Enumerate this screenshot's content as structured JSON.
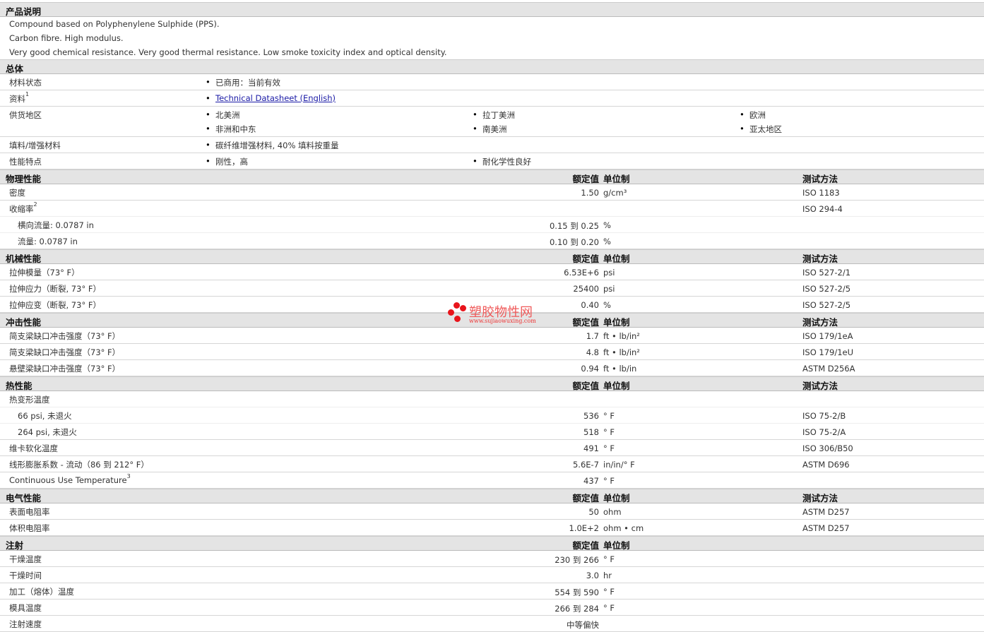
{
  "sections": [
    {
      "title": "产品说明",
      "desc": [
        "Compound based on Polyphenylene Sulphide (PPS).",
        "Carbon fibre. High modulus.",
        "Very good chemical resistance. Very good thermal resistance. Low smoke toxicity index and optical density."
      ]
    },
    {
      "title": "总体",
      "general": [
        {
          "label": "材料状态",
          "items": [
            "已商用：当前有效"
          ]
        },
        {
          "label": "资料",
          "sup": "1",
          "items": [
            "Technical Datasheet (English)"
          ],
          "link": true
        },
        {
          "label": "供货地区",
          "items": [
            "北美洲",
            "拉丁美洲",
            "欧洲",
            "非洲和中东",
            "南美洲",
            "亚太地区"
          ]
        },
        {
          "label": "填料/增强材料",
          "items": [
            "碳纤维增强材料, 40% 填料按重量"
          ]
        },
        {
          "label": "性能特点",
          "items": [
            "刚性，高",
            "耐化学性良好"
          ]
        }
      ]
    },
    {
      "title": "物理性能",
      "cols": [
        "额定值",
        "单位制",
        "测试方法"
      ],
      "rows": [
        {
          "label": "密度",
          "value": "1.50",
          "unit": "g/cm³",
          "method": "ISO 1183"
        },
        {
          "label": "收缩率",
          "sup": "2",
          "method": "ISO 294-4",
          "sub": true
        },
        {
          "label": "横向流量: 0.0787 in",
          "value": "0.15 到  0.25",
          "unit": "%",
          "indent": true,
          "sub": true
        },
        {
          "label": "流量: 0.0787 in",
          "value": "0.10 到  0.20",
          "unit": "%",
          "indent": true
        }
      ]
    },
    {
      "title": "机械性能",
      "cols": [
        "额定值",
        "单位制",
        "测试方法"
      ],
      "rows": [
        {
          "label": "拉伸模量（73° F）",
          "value": "6.53E+6",
          "unit": "psi",
          "method": "ISO 527-2/1"
        },
        {
          "label": "拉伸应力（断裂, 73° F）",
          "value": "25400",
          "unit": "psi",
          "method": "ISO 527-2/5"
        },
        {
          "label": "拉伸应变（断裂, 73° F）",
          "value": "0.40",
          "unit": "%",
          "method": "ISO 527-2/5"
        }
      ]
    },
    {
      "title": "冲击性能",
      "cols": [
        "额定值",
        "单位制",
        "测试方法"
      ],
      "rows": [
        {
          "label": "简支梁缺口冲击强度（73° F）",
          "value": "1.7",
          "unit": "ft • lb/in²",
          "method": "ISO 179/1eA"
        },
        {
          "label": "简支梁缺口冲击强度（73° F）",
          "value": "4.8",
          "unit": "ft • lb/in²",
          "method": "ISO 179/1eU"
        },
        {
          "label": "悬壁梁缺口冲击强度（73° F）",
          "value": "0.94",
          "unit": "ft • lb/in",
          "method": "ASTM D256A"
        }
      ]
    },
    {
      "title": "热性能",
      "cols": [
        "额定值",
        "单位制",
        "测试方法"
      ],
      "rows": [
        {
          "label": "热变形温度",
          "sub": true
        },
        {
          "label": "66 psi, 未退火",
          "value": "536",
          "unit": "° F",
          "method": "ISO 75-2/B",
          "indent": true,
          "sub": true
        },
        {
          "label": "264 psi, 未退火",
          "value": "518",
          "unit": "° F",
          "method": "ISO 75-2/A",
          "indent": true
        },
        {
          "label": "维卡软化温度",
          "value": "491",
          "unit": "° F",
          "method": "ISO 306/B50"
        },
        {
          "label": "线形膨胀系数 - 流动（86 到  212° F）",
          "value": "5.6E-7",
          "unit": "in/in/° F",
          "method": "ASTM D696"
        },
        {
          "label": "Continuous Use Temperature",
          "sup": "3",
          "value": "437",
          "unit": "° F"
        }
      ]
    },
    {
      "title": "电气性能",
      "cols": [
        "额定值",
        "单位制",
        "测试方法"
      ],
      "rows": [
        {
          "label": "表面电阻率",
          "value": "50",
          "unit": "ohm",
          "method": "ASTM D257"
        },
        {
          "label": "体积电阻率",
          "value": "1.0E+2",
          "unit": "ohm • cm",
          "method": "ASTM D257"
        }
      ]
    },
    {
      "title": "注射",
      "cols": [
        "额定值",
        "单位制",
        ""
      ],
      "rows": [
        {
          "label": "干燥温度",
          "value": "230 到  266",
          "unit": "° F"
        },
        {
          "label": "干燥时间",
          "value": "3.0",
          "unit": "hr"
        },
        {
          "label": "加工（熔体）温度",
          "value": "554 到  590",
          "unit": "° F"
        },
        {
          "label": "模具温度",
          "value": "266 到  284",
          "unit": "° F"
        },
        {
          "label": "注射速度",
          "value": "中等偏快"
        }
      ]
    }
  ],
  "watermark": {
    "name": "塑胶物性网",
    "url": "www.sujiaowuxing.com"
  }
}
